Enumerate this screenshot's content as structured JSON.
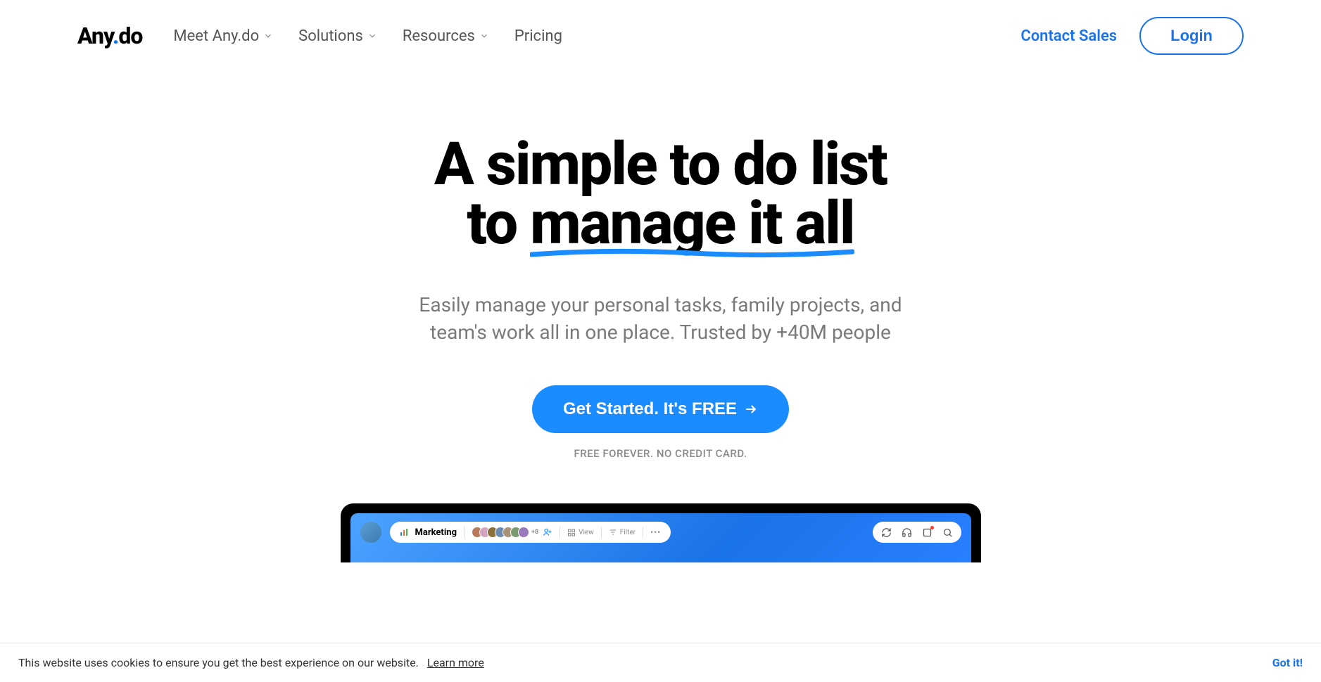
{
  "header": {
    "logo_prefix": "Any",
    "logo_suffix": "do",
    "nav_items": [
      {
        "label": "Meet Any.do",
        "has_dropdown": true
      },
      {
        "label": "Solutions",
        "has_dropdown": true
      },
      {
        "label": "Resources",
        "has_dropdown": true
      },
      {
        "label": "Pricing",
        "has_dropdown": false
      }
    ],
    "contact_sales": "Contact Sales",
    "login": "Login"
  },
  "hero": {
    "title_line1": "A simple to do list",
    "title_line2_prefix": "to ",
    "title_line2_underlined": "manage it all",
    "subtitle_line1": "Easily manage your personal tasks, family projects, and",
    "subtitle_line2": "team's work all in one place. Trusted by +40M people",
    "cta_label": "Get Started. It's FREE",
    "cta_subtext": "FREE FOREVER. NO CREDIT CARD."
  },
  "app_preview": {
    "project_name": "Marketing",
    "more_count": "+8",
    "view_label": "View",
    "filter_label": "Filter",
    "avatar_colors": [
      "#b87a5a",
      "#d4a5c0",
      "#8b6f3a",
      "#6b8cae",
      "#a89278",
      "#7a9b6f",
      "#9b7abb"
    ]
  },
  "cookie": {
    "text": "This website uses cookies to ensure you get the best experience on our website.",
    "link": "Learn more",
    "close": "Got it!"
  },
  "colors": {
    "primary_blue": "#1a73e8",
    "cta_blue": "#1a8cff"
  }
}
